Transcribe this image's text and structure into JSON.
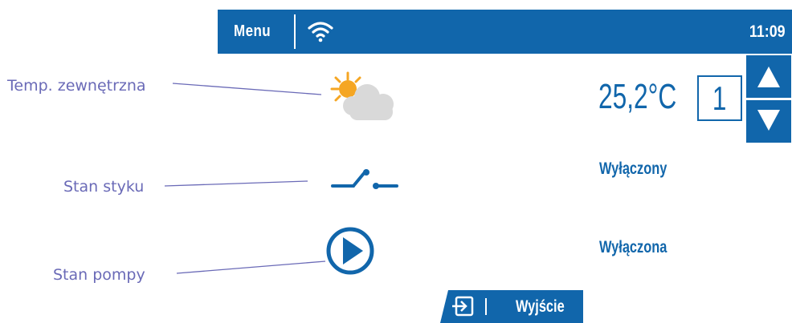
{
  "topbar": {
    "menu_label": "Menu",
    "time": "11:09",
    "icons": [
      "wifi-icon"
    ]
  },
  "annotations": {
    "outdoor_temp": "Temp. zewnętrzna",
    "contact_state": "Stan styku",
    "pump_state": "Stan pompy"
  },
  "readings": {
    "temperature": "25,2°C",
    "setting_value": "1",
    "contact_status": "Wyłączony",
    "pump_status": "Wyłączona"
  },
  "exit_button": {
    "label": "Wyjście"
  },
  "colors": {
    "brand_blue": "#1166ab",
    "annotation_text": "#6a6ab7",
    "sun": "#f5a623",
    "cloud": "#d9d9d9"
  }
}
